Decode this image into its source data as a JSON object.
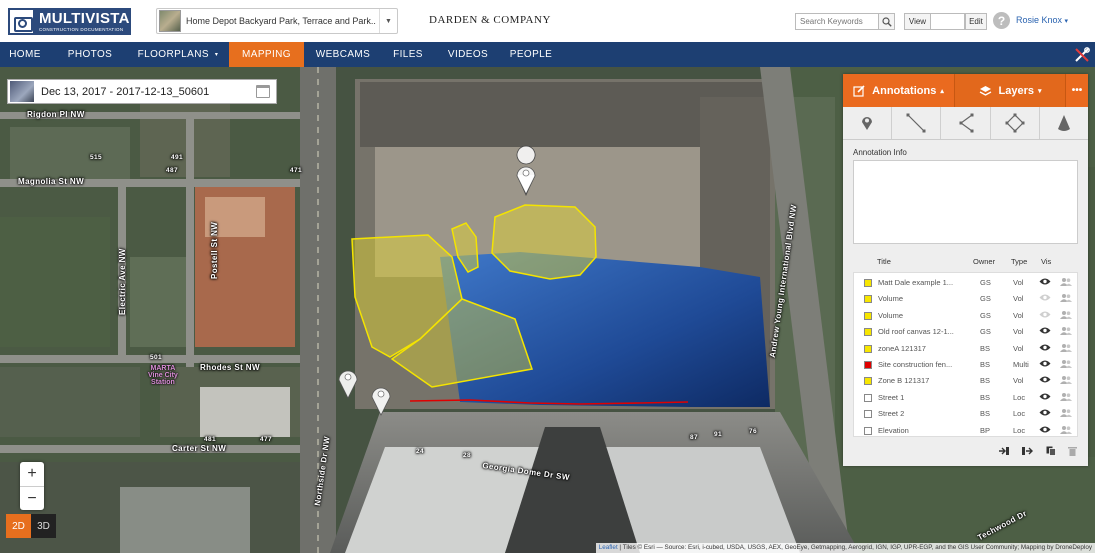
{
  "header": {
    "logo_name": "MULTIVISTA",
    "logo_sub": "CONSTRUCTION DOCUMENTATION",
    "project": "Home Depot Backyard Park, Terrace and Park...",
    "client": "DARDEN & COMPANY",
    "search_placeholder": "Search Keywords",
    "view_label": "View",
    "edit_label": "Edit",
    "help_symbol": "?",
    "user_name": "Rosie Knox",
    "user_caret": "▾"
  },
  "nav": {
    "items": [
      {
        "label": "HOME"
      },
      {
        "label": "PHOTOS"
      },
      {
        "label": "FLOORPLANS",
        "dropdown": "▾"
      },
      {
        "label": "MAPPING",
        "active": true
      },
      {
        "label": "WEBCAMS"
      },
      {
        "label": "FILES"
      },
      {
        "label": "VIDEOS"
      },
      {
        "label": "PEOPLE"
      }
    ]
  },
  "map": {
    "capture_date": "Dec 13, 2017 - 2017-12-13_50601",
    "zoom_in": "+",
    "zoom_out": "−",
    "mode_2d": "2D",
    "mode_3d": "3D",
    "attribution_leaflet": "Leaflet",
    "attribution_text": " | Tiles © Esri — Source: Esri, i-cubed, USDA, USGS, AEX, GeoEye, Getmapping, Aerogrid, IGN, IGP, UPR-EGP, and the GIS User Community; Mapping by DroneDeploy",
    "labels": {
      "rigdon": "Rigdon Pl NW",
      "magnolia": "Magnolia St NW",
      "electric": "Electric Ave NW",
      "postell": "Postell St NW",
      "rhodes": "Rhodes St NW",
      "carter": "Carter St NW",
      "northside": "Northside Dr NW",
      "georgia_dome": "Georgia Dome Dr SW",
      "andrew_young": "Andrew Young International Blvd NW",
      "techwood": "Techwood Dr",
      "marta": "MARTA\nVine City\nStation",
      "n487": "487",
      "n471": "471",
      "n515": "515",
      "n491": "491",
      "n501": "501",
      "n481": "481",
      "n477": "477",
      "n24": "24",
      "n28": "28",
      "n87": "87",
      "n91": "91",
      "n76": "76"
    }
  },
  "panel": {
    "tab_annotations": "Annotations",
    "tab_layers": "Layers",
    "tab_caret": "▴",
    "layers_caret": "▾",
    "more": "•••",
    "info_label": "Annotation Info",
    "columns": {
      "title": "Title",
      "owner": "Owner",
      "type": "Type",
      "vis": "Vis"
    },
    "rows": [
      {
        "title": "Matt Dale example 1...",
        "owner": "GS",
        "type": "Vol",
        "color": "#f7e600",
        "visible": true
      },
      {
        "title": "Volume",
        "owner": "GS",
        "type": "Vol",
        "color": "#f7e600",
        "visible": false
      },
      {
        "title": "Volume",
        "owner": "GS",
        "type": "Vol",
        "color": "#f7e600",
        "visible": false
      },
      {
        "title": "Old roof canvas 12-1...",
        "owner": "GS",
        "type": "Vol",
        "color": "#f7e600",
        "visible": true
      },
      {
        "title": "zoneA 121317",
        "owner": "BS",
        "type": "Vol",
        "color": "#f7e600",
        "visible": true
      },
      {
        "title": "Site construction fen...",
        "owner": "BS",
        "type": "Multi",
        "color": "#e00000",
        "visible": true
      },
      {
        "title": "Zone B 121317",
        "owner": "BS",
        "type": "Vol",
        "color": "#f7e600",
        "visible": true
      },
      {
        "title": "Street 1",
        "owner": "BS",
        "type": "Loc",
        "color": "#ffffff",
        "visible": true
      },
      {
        "title": "Street 2",
        "owner": "BS",
        "type": "Loc",
        "color": "#ffffff",
        "visible": true
      },
      {
        "title": "Elevation",
        "owner": "BP",
        "type": "Loc",
        "color": "#ffffff",
        "visible": true
      }
    ]
  },
  "colors": {
    "brand_blue": "#1d3f72",
    "accent_orange": "#e76f1e",
    "annotation_yellow": "#f7e600",
    "fence_red": "#e00000"
  }
}
